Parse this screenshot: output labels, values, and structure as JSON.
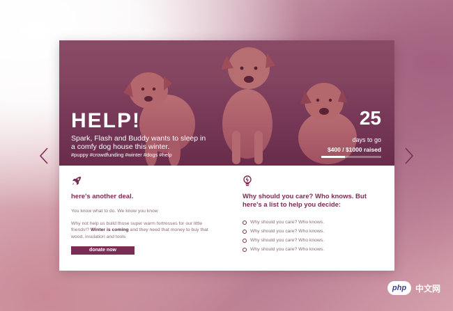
{
  "hero": {
    "title": "HELP!",
    "subtitle": "Spark, Flash and Buddy wants to sleep in a comfy dog house this winter.",
    "tags": "#puppy #crowdfunding #winter #dogs #help",
    "days_number": "25",
    "days_label": "days to go",
    "raised": "$400 / $1000 raised",
    "progress_fraction": 0.4
  },
  "left_column": {
    "icon": "rocket-icon",
    "heading": "here's another deal.",
    "intro": "You know what to do. We know you know",
    "body_before": "Why not help us build those super warm fortresses for our little friends!? ",
    "body_bold": "Winter is coming",
    "body_after": " and they need that money to buy that wood, insulation and tools",
    "button_label": "donate now"
  },
  "right_column": {
    "icon": "lightbulb-icon",
    "heading": "Why should you care? Who knows. But here's a list to help you decide:",
    "items": [
      "Why should you care? Who knows.",
      "Why should you care? Who knows.",
      "Why should you care? Who knows.",
      "Why should you care? Who knows."
    ]
  },
  "navigation": {
    "prev_icon": "chevron-left-icon",
    "next_icon": "chevron-right-icon"
  },
  "watermark": {
    "badge": "php",
    "text": "中文网"
  },
  "colors": {
    "accent": "#7b2c54",
    "text_muted": "#8a6a78",
    "hero_overlay": "#7a2850"
  }
}
